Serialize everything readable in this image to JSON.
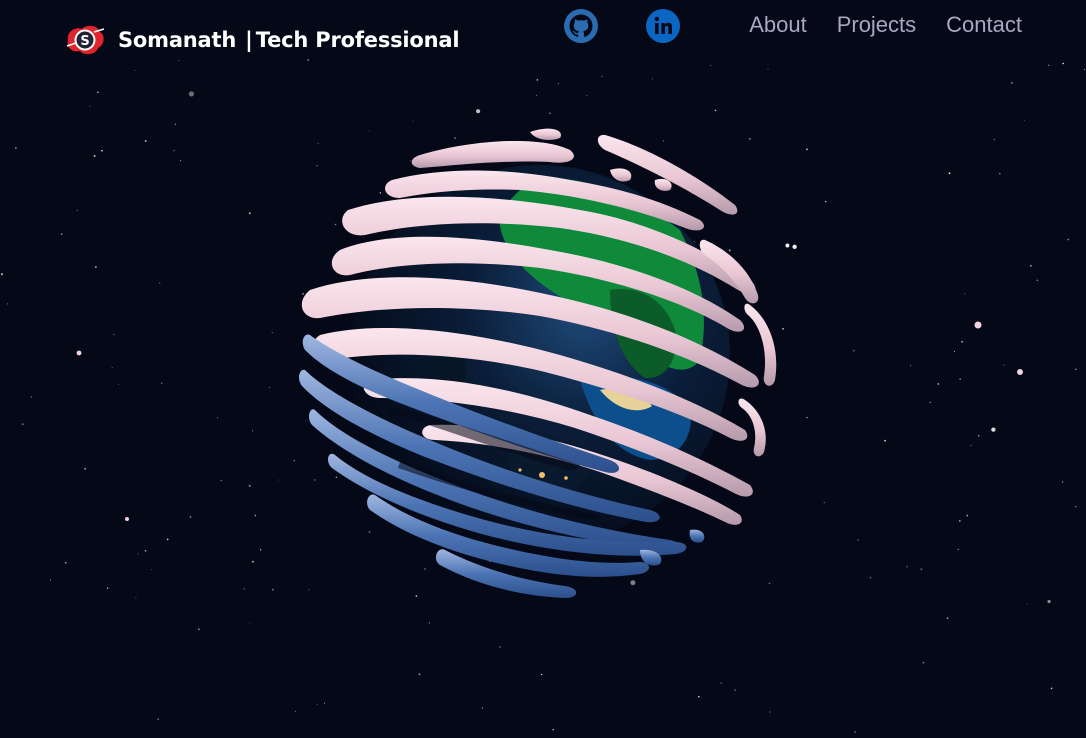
{
  "navbar": {
    "brand": {
      "logo_icon": "s-logo-icon",
      "name": "Somanath",
      "separator": "|",
      "tagline": "Tech Professional"
    },
    "social": [
      {
        "icon": "github-icon",
        "color": "#2b6cb0"
      },
      {
        "icon": "linkedin-icon",
        "color": "#0a66c2"
      }
    ],
    "links": [
      "About",
      "Projects",
      "Contact"
    ]
  },
  "hero": {
    "scene": "3d-earth-globe-with-cloud-bands",
    "background_color": "#050816",
    "colors": {
      "cloud_pink": "#f1d4de",
      "cloud_blue": "#3e68a8",
      "land_green": "#0f8a3b",
      "ocean_dark": "#061120",
      "star_white": "#ffffff"
    }
  }
}
